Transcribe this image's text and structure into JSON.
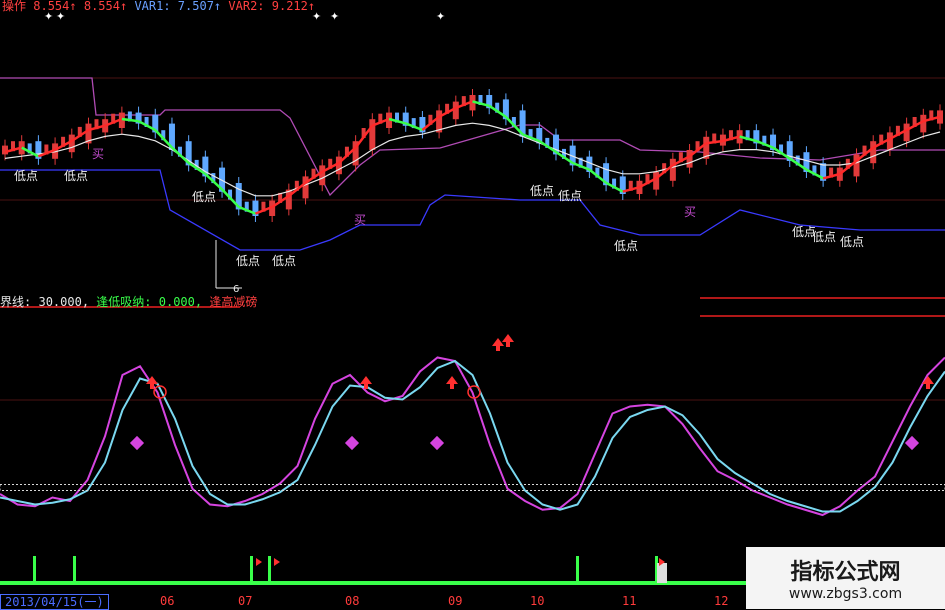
{
  "header_top": {
    "label_op": "操作",
    "op_value": "8.554↑",
    "op_value2": "8.554↑",
    "var1_label": "VAR1:",
    "var1_value": "7.507↑",
    "var2_label": "VAR2:",
    "var2_value": "9.212↑"
  },
  "header_mid": {
    "line_label": "界线:",
    "line_value": "30.000,",
    "absorb_label": "逢低吸纳:",
    "absorb_value": "0.000,",
    "reduce_label": "逢高减磅"
  },
  "markers": {
    "low": "低点",
    "buy": "买",
    "arrow_label": "6"
  },
  "axis": {
    "start_date": "2013/04/15(一)",
    "months": [
      "06",
      "07",
      "08",
      "09",
      "10",
      "11",
      "12"
    ]
  },
  "watermark": {
    "title": "指标公式网",
    "url": "www.zbgs3.com"
  },
  "colors": {
    "background": "#000000",
    "up_candle": "#e23a3a",
    "down_candle": "#5fa8ff",
    "ma_white": "#e8e8e8",
    "ma_green": "#39ff4a",
    "ma_red": "#ff2a2a",
    "channel_upper": "#b04bb4",
    "channel_lower": "#3a3aff",
    "osc_magenta": "#d544e0",
    "osc_cyan": "#7ad8f0",
    "threshold": "#d8d8d8",
    "volume": "#39ff4a"
  },
  "chart_data": [
    {
      "type": "line",
      "name": "price",
      "series": [
        {
          "values": [
            50,
            52,
            48,
            51,
            55,
            60,
            62,
            65,
            64,
            60,
            52,
            45,
            40,
            33,
            25,
            22,
            25,
            30,
            36,
            41,
            45,
            52,
            62,
            65,
            63,
            60,
            66,
            70,
            73,
            71,
            66,
            58,
            55,
            50,
            45,
            42,
            36,
            32,
            34,
            38,
            44,
            48,
            54,
            55,
            57,
            55,
            52,
            47,
            42,
            38,
            40,
            46,
            52,
            56,
            60,
            64,
            66
          ]
        },
        {
          "values": [
            48,
            49,
            50,
            51,
            53,
            56,
            58,
            59,
            58,
            56,
            52,
            47,
            42,
            38,
            34,
            31,
            31,
            33,
            36,
            39,
            43,
            47,
            52,
            56,
            58,
            59,
            61,
            63,
            64,
            63,
            61,
            58,
            55,
            52,
            49,
            46,
            43,
            41,
            41,
            42,
            44,
            46,
            49,
            51,
            52,
            52,
            51,
            49,
            47,
            45,
            45,
            46,
            49,
            52,
            55,
            58,
            60
          ]
        }
      ]
    },
    {
      "type": "line",
      "name": "oscillator",
      "series": [
        {
          "values": [
            12,
            6,
            5,
            10,
            8,
            20,
            45,
            80,
            85,
            70,
            40,
            15,
            6,
            5,
            8,
            12,
            18,
            28,
            55,
            75,
            80,
            70,
            65,
            68,
            82,
            90,
            88,
            70,
            40,
            15,
            8,
            3,
            4,
            12,
            35,
            58,
            62,
            63,
            62,
            52,
            38,
            25,
            20,
            14,
            10,
            6,
            3,
            0,
            5,
            14,
            22,
            42,
            62,
            80,
            90
          ]
        },
        {
          "values": [
            10,
            8,
            6,
            7,
            9,
            14,
            30,
            60,
            78,
            75,
            55,
            28,
            12,
            6,
            6,
            9,
            13,
            20,
            40,
            62,
            74,
            73,
            67,
            66,
            73,
            84,
            88,
            80,
            58,
            30,
            14,
            6,
            3,
            6,
            22,
            44,
            56,
            60,
            62,
            57,
            46,
            32,
            24,
            18,
            12,
            8,
            5,
            2,
            2,
            8,
            16,
            30,
            50,
            68,
            82
          ]
        }
      ],
      "threshold": 30
    }
  ]
}
